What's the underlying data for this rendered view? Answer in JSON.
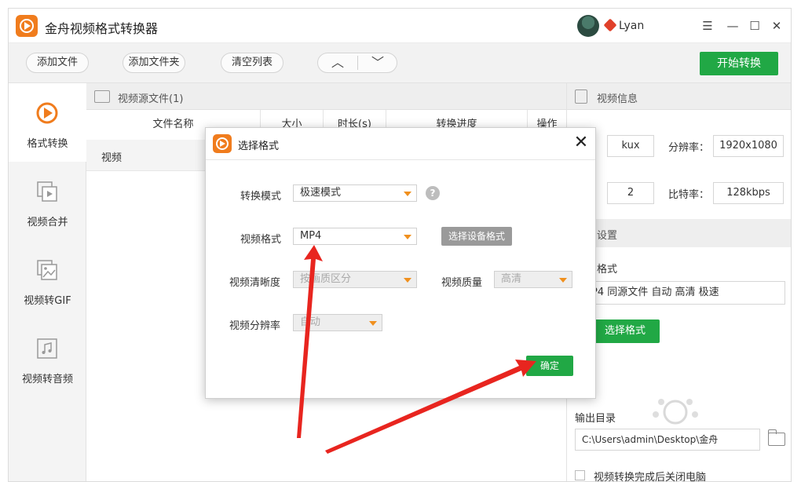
{
  "app": {
    "title": "金舟视频格式转换器",
    "user_name": "Lyan",
    "window_controls": [
      "☰",
      "—",
      "☐",
      "✕"
    ]
  },
  "toolbar": {
    "add_file": "添加文件",
    "add_folder": "添加文件夹",
    "clear_list": "清空列表",
    "move_up": "︿",
    "move_down": "﹀",
    "start": "开始转换"
  },
  "sidebar": {
    "items": [
      {
        "label": "格式转换",
        "icon": "convert-icon",
        "active": true
      },
      {
        "label": "视频合并",
        "icon": "merge-icon",
        "active": false
      },
      {
        "label": "视频转GIF",
        "icon": "gif-icon",
        "active": false
      },
      {
        "label": "视频转音频",
        "icon": "audio-icon",
        "active": false
      }
    ]
  },
  "file_panel": {
    "title": "视频源文件(1)",
    "columns": [
      "文件名称",
      "大小",
      "时长(s)",
      "转换进度",
      "操作"
    ],
    "rows": [
      {
        "name": "视频"
      }
    ]
  },
  "info_panel": {
    "title": "视频信息",
    "format_value": "kux",
    "resolution_label": "分辨率：",
    "resolution_value": "1920x1080",
    "second_value": "2",
    "bitrate_label": "比特率：",
    "bitrate_value": "128kbps",
    "settings_title": "设置",
    "output_format_label": "格式",
    "output_format_value": "P4 同源文件 自动 高清 极速",
    "select_format_btn": "选择格式",
    "output_dir_label": "输出目录",
    "output_dir_value": "C:\\Users\\admin\\Desktop\\金舟",
    "shutdown_label": "视频转换完成后关闭电脑"
  },
  "dialog": {
    "title": "选择格式",
    "close": "✕",
    "mode_label": "转换模式",
    "mode_value": "极速模式",
    "help": "?",
    "format_label": "视频格式",
    "format_value": "MP4",
    "device_btn": "选择设备格式",
    "clarity_label": "视频清晰度",
    "clarity_value": "按画质区分",
    "quality_label": "视频质量",
    "quality_value": "高清",
    "res_label": "视频分辨率",
    "res_value": "自动",
    "ok": "确定"
  },
  "colors": {
    "accent_green": "#21a845",
    "brand_orange": "#f07c1d",
    "arrow_red": "#e8251f"
  }
}
